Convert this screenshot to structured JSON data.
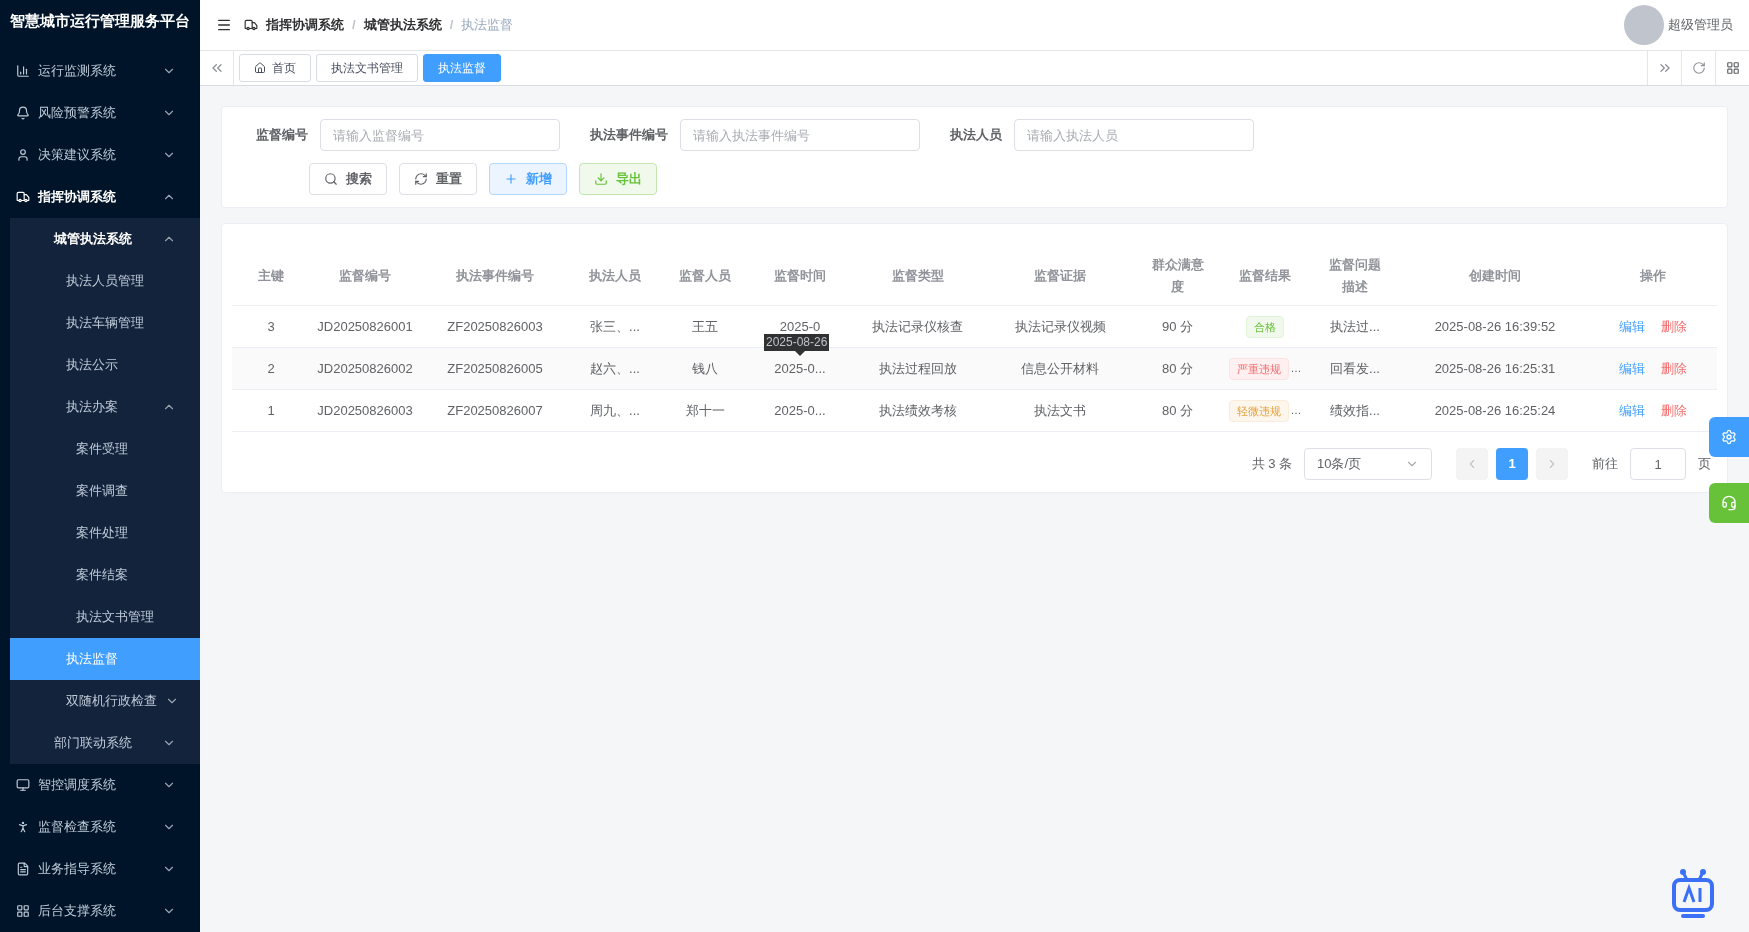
{
  "sidebar": {
    "title": "智慧城市运行管理服务平台",
    "items": [
      {
        "label": "运行监测系统",
        "expanded": false
      },
      {
        "label": "风险预警系统",
        "expanded": false
      },
      {
        "label": "决策建议系统",
        "expanded": false
      },
      {
        "label": "指挥协调系统",
        "expanded": true,
        "children": [
          {
            "label": "城管执法系统",
            "expanded": true,
            "children": [
              {
                "label": "执法人员管理",
                "selected": false
              },
              {
                "label": "执法车辆管理",
                "selected": false
              },
              {
                "label": "执法公示",
                "selected": false
              },
              {
                "label": "执法办案",
                "expanded": true,
                "children": [
                  {
                    "label": "案件受理",
                    "selected": false
                  },
                  {
                    "label": "案件调查",
                    "selected": false
                  },
                  {
                    "label": "案件处理",
                    "selected": false
                  },
                  {
                    "label": "案件结案",
                    "selected": false
                  },
                  {
                    "label": "执法文书管理",
                    "selected": false
                  }
                ]
              },
              {
                "label": "执法监督",
                "selected": true
              },
              {
                "label": "双随机行政检查",
                "expanded": false
              }
            ]
          },
          {
            "label": "部门联动系统",
            "expanded": false
          }
        ]
      },
      {
        "label": "智控调度系统",
        "expanded": false
      },
      {
        "label": "监督检查系统",
        "expanded": false
      },
      {
        "label": "业务指导系统",
        "expanded": false
      },
      {
        "label": "后台支撑系统",
        "expanded": false
      }
    ]
  },
  "breadcrumb": {
    "separator": "/",
    "items": [
      "指挥协调系统",
      "城管执法系统",
      "执法监督"
    ]
  },
  "user": {
    "name": "超级管理员"
  },
  "tabs": [
    {
      "label": "首页",
      "selected": false
    },
    {
      "label": "执法文书管理",
      "selected": false
    },
    {
      "label": "执法监督",
      "selected": true
    }
  ],
  "search": {
    "fields": [
      {
        "label": "监督编号",
        "placeholder": "请输入监督编号"
      },
      {
        "label": "执法事件编号",
        "placeholder": "请输入执法事件编号"
      },
      {
        "label": "执法人员",
        "placeholder": "请输入执法人员"
      }
    ],
    "buttons": [
      {
        "label": "搜索",
        "kind": "search"
      },
      {
        "label": "重置",
        "kind": "reset"
      },
      {
        "label": "新增",
        "kind": "add"
      },
      {
        "label": "导出",
        "kind": "export"
      }
    ]
  },
  "table": {
    "columns": [
      "主键",
      "监督编号",
      "执法事件编号",
      "执法人员",
      "监督人员",
      "监督时间",
      "监督类型",
      "监督证据",
      "群众满意度",
      "监督结果",
      "监督问题描述",
      "创建时间",
      "操作"
    ],
    "rows": [
      {
        "id": "3",
        "code": "JD20250826001",
        "event": "ZF20250826003",
        "officer": "张三、...",
        "supervisor": "王五",
        "time": "2025-0",
        "type": "执法记录仪核查",
        "evidence": "执法记录仪视频",
        "score": "90 分",
        "result": {
          "label": "合格",
          "kind": "success"
        },
        "desc": "执法过...",
        "created": "2025-08-26 16:39:52",
        "actions": [
          "编辑",
          "删除"
        ]
      },
      {
        "id": "2",
        "code": "JD20250826002",
        "event": "ZF20250826005",
        "officer": "赵六、...",
        "supervisor": "钱八",
        "time": "2025-0...",
        "type": "执法过程回放",
        "evidence": "信息公开材料",
        "score": "80 分",
        "result": {
          "label": "严重违规",
          "kind": "danger",
          "trail": "…"
        },
        "desc": "回看发...",
        "created": "2025-08-26 16:25:31",
        "actions": [
          "编辑",
          "删除"
        ]
      },
      {
        "id": "1",
        "code": "JD20250826003",
        "event": "ZF20250826007",
        "officer": "周九、...",
        "supervisor": "郑十一",
        "time": "2025-0...",
        "type": "执法绩效考核",
        "evidence": "执法文书",
        "score": "80 分",
        "result": {
          "label": "轻微违规",
          "kind": "warning",
          "trail": "…"
        },
        "desc": "绩效指...",
        "created": "2025-08-26 16:25:24",
        "actions": [
          "编辑",
          "删除"
        ]
      }
    ],
    "tooltip": "2025-08-26"
  },
  "pagination": {
    "total": "共 3 条",
    "page_size": "10条/页",
    "pages": [
      {
        "label": "1",
        "selected": true
      }
    ],
    "goto_label": "前往",
    "goto_value": "1",
    "goto_suffix": "页"
  }
}
